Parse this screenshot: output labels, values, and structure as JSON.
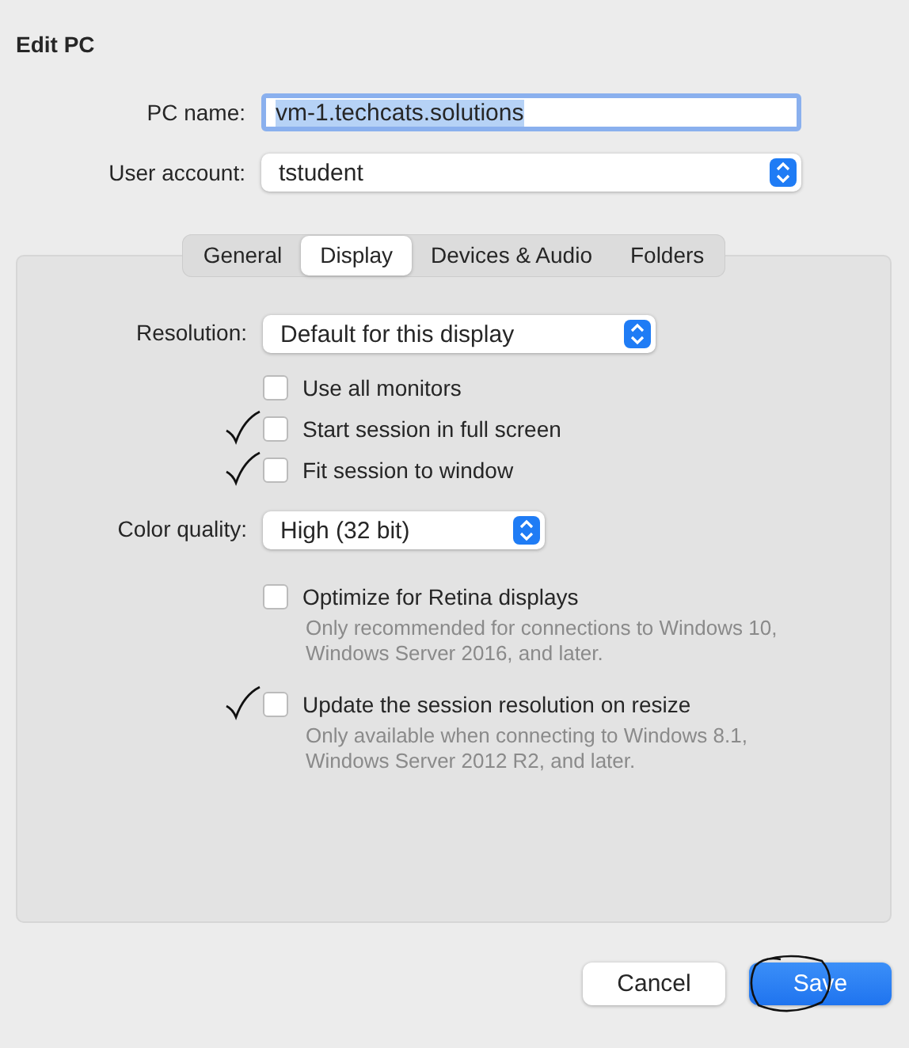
{
  "window": {
    "title": "Edit PC"
  },
  "fields": [
    {
      "kind": "text",
      "label": "PC name:",
      "value": "vm-1.techcats.solutions",
      "focused": true
    },
    {
      "kind": "popup",
      "label": "User account:",
      "value": "tstudent"
    }
  ],
  "tabs": [
    {
      "label": "General",
      "selected": false
    },
    {
      "label": "Display",
      "selected": true
    },
    {
      "label": "Devices & Audio",
      "selected": false
    },
    {
      "label": "Folders",
      "selected": false
    }
  ],
  "display": [
    {
      "kind": "popup",
      "label": "Resolution:",
      "value": "Default for this display"
    },
    {
      "kind": "checkbox",
      "label": "Use all monitors",
      "checked": false,
      "handwritten_mark": false
    },
    {
      "kind": "checkbox",
      "label": "Start session in full screen",
      "checked": false,
      "handwritten_mark": true
    },
    {
      "kind": "checkbox",
      "label": "Fit session to window",
      "checked": false,
      "handwritten_mark": true
    },
    {
      "kind": "short_popup",
      "label": "Color quality:",
      "value": "High (32 bit)"
    },
    {
      "kind": "checkbox",
      "label": "Optimize for Retina displays",
      "checked": false,
      "handwritten_mark": false,
      "note": "Only recommended for connections to Windows 10, Windows Server 2016, and later."
    },
    {
      "kind": "checkbox",
      "label": "Update the session resolution on resize",
      "checked": false,
      "handwritten_mark": true,
      "note": "Only available when connecting to Windows 8.1, Windows Server 2012 R2, and later."
    }
  ],
  "buttons": [
    {
      "label": "Cancel",
      "primary": false,
      "circled": false
    },
    {
      "label": "Save",
      "primary": true,
      "circled": true
    }
  ]
}
